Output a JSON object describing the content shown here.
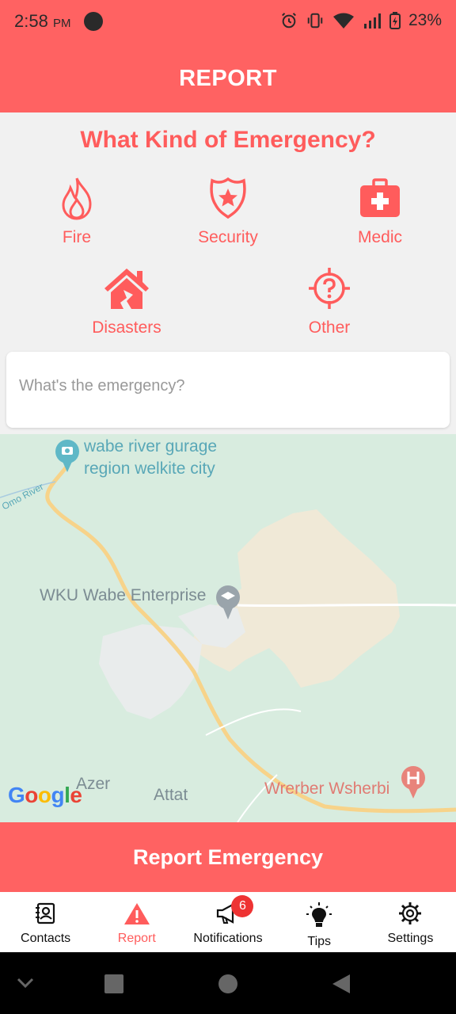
{
  "status_bar": {
    "time": "2:58",
    "ampm": "PM",
    "battery": "23%"
  },
  "app_bar": {
    "title": "REPORT"
  },
  "heading": "What Kind of Emergency?",
  "categories": [
    {
      "label": "Fire",
      "icon": "fire-icon"
    },
    {
      "label": "Security",
      "icon": "police-badge-icon"
    },
    {
      "label": "Medic",
      "icon": "first-aid-kit-icon"
    },
    {
      "label": "Disasters",
      "icon": "broken-house-icon"
    },
    {
      "label": "Other",
      "icon": "question-target-icon"
    }
  ],
  "description": {
    "placeholder": "What's the emergency?"
  },
  "map": {
    "labels": {
      "place1": "wabe river gurage",
      "place1b": "region welkite city",
      "river": "Omo River",
      "enterprise": "WKU Wabe Enterprise",
      "azer": "Azer",
      "attat": "Attat",
      "wrerber": "Wrerber Wsherbi"
    },
    "logo": "Google"
  },
  "report_button": "Report Emergency",
  "bottom_nav": {
    "items": [
      {
        "label": "Contacts"
      },
      {
        "label": "Report"
      },
      {
        "label": "Notifications",
        "badge": "6"
      },
      {
        "label": "Tips"
      },
      {
        "label": "Settings"
      }
    ]
  },
  "colors": {
    "accent": "#ff6262",
    "heading": "#ff5c5c",
    "map_bg": "#d8ecdf"
  }
}
